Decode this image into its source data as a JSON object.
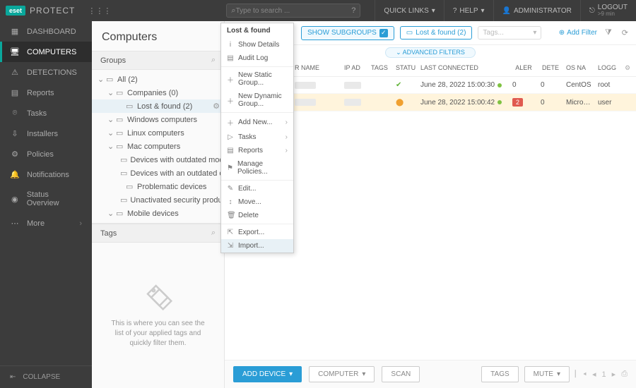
{
  "brand": {
    "logo": "eset",
    "name": "PROTECT"
  },
  "topbar": {
    "search_placeholder": "Type to search ...",
    "quick_links": "QUICK LINKS",
    "help": "HELP",
    "admin": "ADMINISTRATOR",
    "logout": "LOGOUT",
    "logout_sub": ">9 min"
  },
  "sidebar": {
    "items": [
      {
        "icon": "▦",
        "label": "DASHBOARD"
      },
      {
        "icon": "🖥",
        "label": "COMPUTERS"
      },
      {
        "icon": "⚠",
        "label": "DETECTIONS"
      },
      {
        "icon": "▤",
        "label": "Reports"
      },
      {
        "icon": "⌾",
        "label": "Tasks"
      },
      {
        "icon": "⇩",
        "label": "Installers"
      },
      {
        "icon": "⚙",
        "label": "Policies"
      },
      {
        "icon": "🔔",
        "label": "Notifications"
      },
      {
        "icon": "◉",
        "label": "Status Overview"
      },
      {
        "icon": "⋯",
        "label": "More"
      }
    ],
    "collapse": "COLLAPSE"
  },
  "groups": {
    "title": "Computers",
    "header": "Groups",
    "tree": [
      {
        "indent": 0,
        "chev": "⌄",
        "icon": "▭",
        "label": "All (2)"
      },
      {
        "indent": 1,
        "chev": "⌄",
        "icon": "▭",
        "label": "Companies (0)"
      },
      {
        "indent": 2,
        "chev": "",
        "icon": "▭",
        "label": "Lost & found (2)",
        "sel": true,
        "gear": true
      },
      {
        "indent": 1,
        "chev": "⌄",
        "icon": "▭",
        "label": "Windows computers"
      },
      {
        "indent": 1,
        "chev": "⌄",
        "icon": "▭",
        "label": "Linux computers"
      },
      {
        "indent": 1,
        "chev": "⌄",
        "icon": "▭",
        "label": "Mac computers"
      },
      {
        "indent": 2,
        "chev": "",
        "icon": "▭",
        "label": "Devices with outdated modules"
      },
      {
        "indent": 2,
        "chev": "",
        "icon": "▭",
        "label": "Devices with an outdated operating sy…"
      },
      {
        "indent": 2,
        "chev": "",
        "icon": "▭",
        "label": "Problematic devices"
      },
      {
        "indent": 2,
        "chev": "",
        "icon": "▭",
        "label": "Unactivated security product"
      },
      {
        "indent": 1,
        "chev": "⌄",
        "icon": "▭",
        "label": "Mobile devices"
      }
    ],
    "tags_header": "Tags",
    "tags_empty": "This is where you can see the list of your applied tags and quickly filter them."
  },
  "main": {
    "chips": {
      "show_sub": "SHOW SUBGROUPS",
      "lost": "Lost & found (2)",
      "tags_ph": "Tags...",
      "add_filter": "Add Filter"
    },
    "adv": "ADVANCED FILTERS",
    "cols": {
      "name": "R NAME",
      "ip": "IP AD",
      "tags": "TAGS",
      "stat": "STATU",
      "last": "LAST CONNECTED",
      "alert": "ALER",
      "det": "DETE",
      "os": "OS NA",
      "log": "LOGG"
    },
    "rows": [
      {
        "stat": "ok",
        "last": "June 28, 2022 15:00:30",
        "alert": "0",
        "det": "0",
        "os": "CentOS",
        "log": "root"
      },
      {
        "stat": "warn",
        "last": "June 28, 2022 15:00:42",
        "alert": "2",
        "alert_red": true,
        "det": "0",
        "os": "Micro…",
        "log": "user"
      }
    ]
  },
  "footer": {
    "add_device": "ADD DEVICE",
    "computer": "COMPUTER",
    "scan": "SCAN",
    "tags": "TAGS",
    "mute": "MUTE",
    "page": "1"
  },
  "ctx": {
    "title": "Lost & found",
    "items": [
      {
        "ic": "i",
        "label": "Show Details"
      },
      {
        "ic": "▤",
        "label": "Audit Log"
      },
      {
        "sep": true
      },
      {
        "ic": "＋",
        "label": "New Static Group..."
      },
      {
        "ic": "＋",
        "label": "New Dynamic Group..."
      },
      {
        "sep": true
      },
      {
        "ic": "＋",
        "label": "Add New...",
        "sub": true
      },
      {
        "ic": "▷",
        "label": "Tasks",
        "sub": true
      },
      {
        "ic": "▤",
        "label": "Reports",
        "sub": true
      },
      {
        "ic": "⚑",
        "label": "Manage Policies..."
      },
      {
        "sep": true
      },
      {
        "ic": "✎",
        "label": "Edit..."
      },
      {
        "ic": "↕",
        "label": "Move..."
      },
      {
        "ic": "🗑",
        "label": "Delete"
      },
      {
        "sep": true
      },
      {
        "ic": "⇱",
        "label": "Export..."
      },
      {
        "ic": "⇲",
        "label": "Import...",
        "hl": true
      }
    ]
  }
}
